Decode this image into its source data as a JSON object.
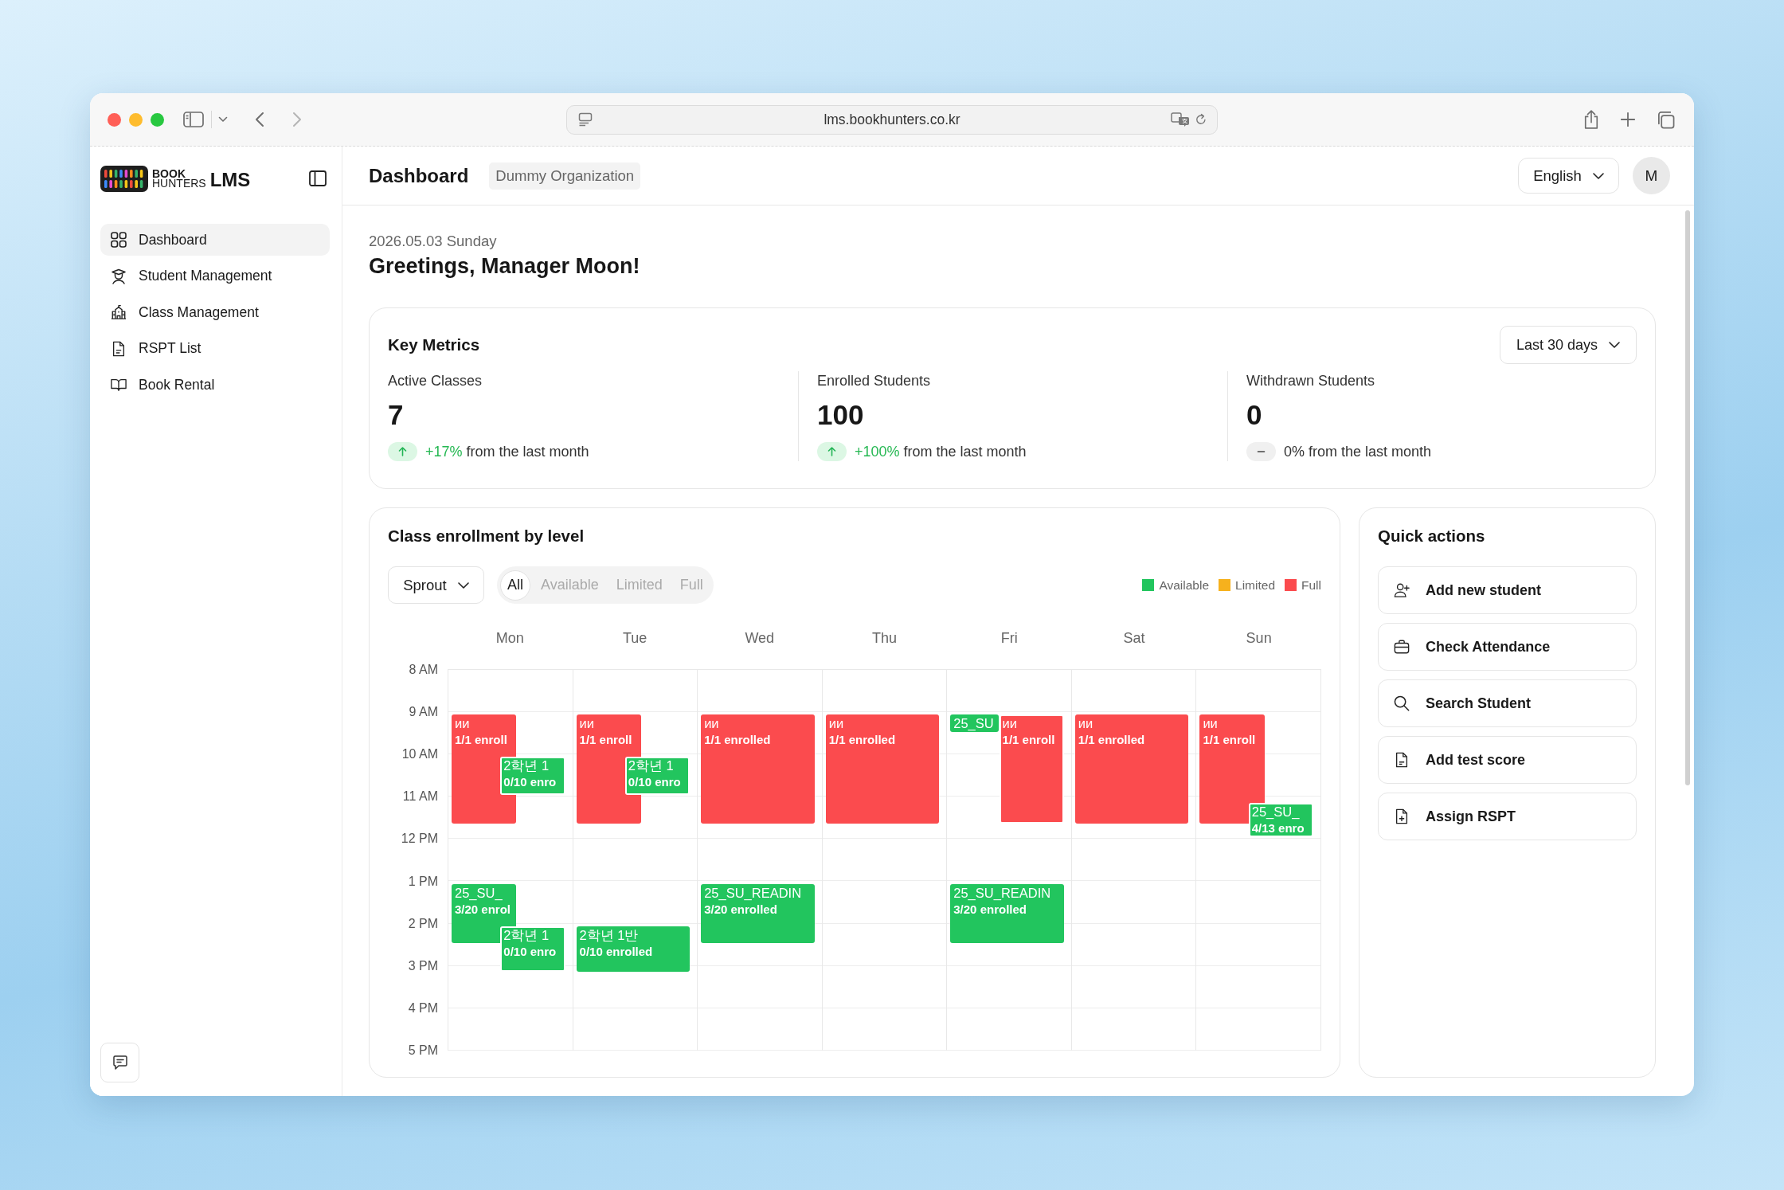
{
  "browser": {
    "url": "lms.bookhunters.co.kr"
  },
  "sidebar": {
    "logo": {
      "line1": "BOOK",
      "line2": "HUNTERS",
      "product": "LMS"
    },
    "items": [
      {
        "label": "Dashboard",
        "selected": true
      },
      {
        "label": "Student Management",
        "selected": false
      },
      {
        "label": "Class Management",
        "selected": false
      },
      {
        "label": "RSPT List",
        "selected": false
      },
      {
        "label": "Book Rental",
        "selected": false
      }
    ]
  },
  "header": {
    "title": "Dashboard",
    "organization": "Dummy Organization",
    "language": "English",
    "avatar": "M"
  },
  "greeting": {
    "date": "2026.05.03 Sunday",
    "text": "Greetings, Manager Moon!"
  },
  "key_metrics": {
    "title": "Key Metrics",
    "period": "Last 30 days",
    "metrics": [
      {
        "label": "Active Classes",
        "value": "7",
        "kind": "up",
        "delta": "+17%",
        "note": "from the last month"
      },
      {
        "label": "Enrolled Students",
        "value": "100",
        "kind": "up",
        "delta": "+100%",
        "note": "from the last month"
      },
      {
        "label": "Withdrawn Students",
        "value": "0",
        "kind": "flat",
        "delta": "0%",
        "note": "from the last month"
      }
    ]
  },
  "enrollment": {
    "title": "Class enrollment by level",
    "level": "Sprout",
    "filters": [
      {
        "label": "All",
        "selected": true
      },
      {
        "label": "Available",
        "selected": false
      },
      {
        "label": "Limited",
        "selected": false
      },
      {
        "label": "Full",
        "selected": false
      }
    ],
    "legend": [
      {
        "label": "Available",
        "color": "#22c55e"
      },
      {
        "label": "Limited",
        "color": "#f6b11d"
      },
      {
        "label": "Full",
        "color": "#fb4b4e"
      }
    ],
    "times": [
      "8 AM",
      "9 AM",
      "10 AM",
      "11 AM",
      "12 PM",
      "1 PM",
      "2 PM",
      "3 PM",
      "4 PM",
      "5 PM"
    ],
    "days": [
      {
        "label": "Mon",
        "events": [
          {
            "title": "ии",
            "enrolled": "1/1 enroll",
            "color": "#fb4b4e"
          },
          {
            "title": "2학년 1",
            "enrolled": "0/10 enro",
            "color": "#22c55e"
          },
          {
            "title": "25_SU_",
            "enrolled": "3/20 enrol",
            "color": "#22c55e"
          },
          {
            "title": "2학년 1",
            "enrolled": "0/10 enro",
            "color": "#22c55e"
          }
        ]
      },
      {
        "label": "Tue",
        "events": [
          {
            "title": "ии",
            "enrolled": "1/1 enroll",
            "color": "#fb4b4e"
          },
          {
            "title": "2학년 1",
            "enrolled": "0/10 enro",
            "color": "#22c55e"
          },
          {
            "title": "2학년 1반",
            "enrolled": "0/10 enrolled",
            "color": "#22c55e"
          }
        ]
      },
      {
        "label": "Wed",
        "events": [
          {
            "title": "ии",
            "enrolled": "1/1 enrolled",
            "color": "#fb4b4e"
          },
          {
            "title": "25_SU_READIN",
            "enrolled": "3/20 enrolled",
            "color": "#22c55e"
          }
        ]
      },
      {
        "label": "Thu",
        "events": [
          {
            "title": "ии",
            "enrolled": "1/1 enrolled",
            "color": "#fb4b4e"
          }
        ]
      },
      {
        "label": "Fri",
        "events": [
          {
            "title": "25_SU",
            "color": "#22c55e"
          },
          {
            "title": "ии",
            "enrolled": "1/1 enroll",
            "color": "#fb4b4e"
          },
          {
            "title": "25_SU_READIN",
            "enrolled": "3/20 enrolled",
            "color": "#22c55e"
          }
        ]
      },
      {
        "label": "Sat",
        "events": [
          {
            "title": "ии",
            "enrolled": "1/1 enrolled",
            "color": "#fb4b4e"
          }
        ]
      },
      {
        "label": "Sun",
        "events": [
          {
            "title": "ии",
            "enrolled": "1/1 enroll",
            "color": "#fb4b4e"
          },
          {
            "title": "25_SU_",
            "enrolled": "4/13 enro",
            "color": "#22c55e"
          }
        ]
      }
    ]
  },
  "quick_actions": {
    "title": "Quick actions",
    "items": [
      "Add new student",
      "Check Attendance",
      "Search Student",
      "Add test score",
      "Assign RSPT"
    ]
  }
}
